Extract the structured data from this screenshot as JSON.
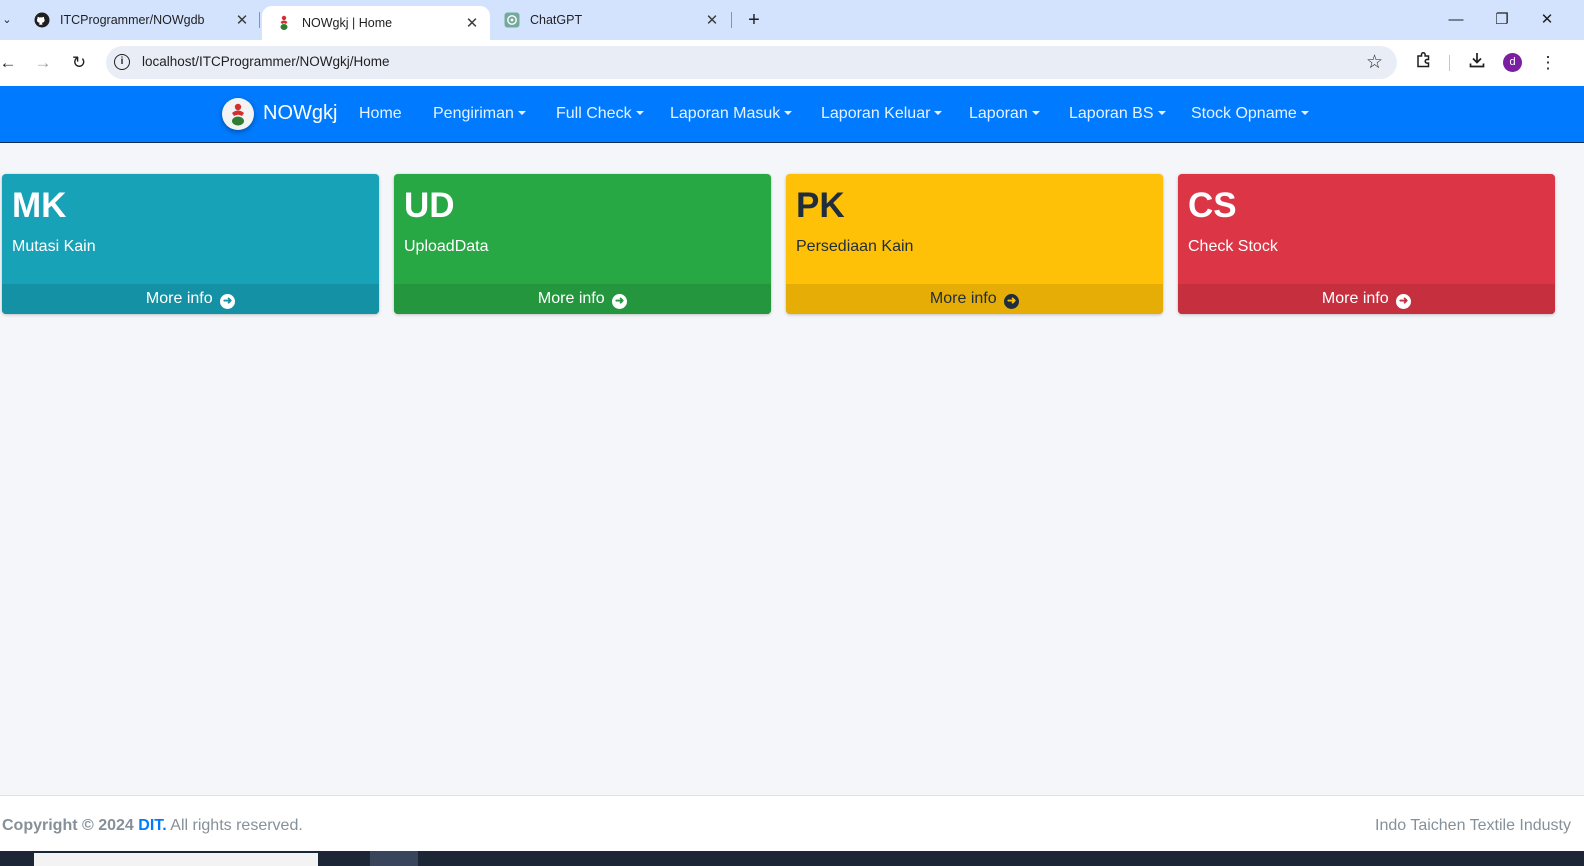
{
  "browser": {
    "tabs": [
      {
        "title": "ITCProgrammer/NOWgdb",
        "icon": "github-icon",
        "close": "✕",
        "active": false
      },
      {
        "title": "NOWgkj | Home",
        "icon": "app-favicon-icon",
        "close": "✕",
        "active": true
      },
      {
        "title": "ChatGPT",
        "icon": "chatgpt-icon",
        "close": "✕",
        "active": false
      }
    ],
    "url": "localhost/ITCProgrammer/NOWgkj/Home",
    "profile_initial": "d"
  },
  "navbar": {
    "brand": "NOWgkj",
    "items": [
      {
        "label": "Home",
        "dropdown": false
      },
      {
        "label": "Pengiriman",
        "dropdown": true
      },
      {
        "label": "Full Check",
        "dropdown": true
      },
      {
        "label": "Laporan Masuk",
        "dropdown": true
      },
      {
        "label": "Laporan Keluar",
        "dropdown": true
      },
      {
        "label": "Laporan",
        "dropdown": true
      },
      {
        "label": "Laporan BS",
        "dropdown": true
      },
      {
        "label": "Stock Opname",
        "dropdown": true
      }
    ]
  },
  "boxes": [
    {
      "code": "MK",
      "desc": "Mutasi Kain",
      "more": "More info",
      "color": "#17a2b8",
      "footer_color": "#1591a5",
      "theme": "light"
    },
    {
      "code": "UD",
      "desc": "UploadData",
      "more": "More info",
      "color": "#28a745",
      "footer_color": "#24963e",
      "theme": "light"
    },
    {
      "code": "PK",
      "desc": "Persediaan Kain",
      "more": "More info",
      "color": "#ffc107",
      "footer_color": "#e5ad06",
      "theme": "dark"
    },
    {
      "code": "CS",
      "desc": "Check Stock",
      "more": "More info",
      "color": "#dc3545",
      "footer_color": "#c62f3e",
      "theme": "light"
    }
  ],
  "footer": {
    "copyright": "Copyright © 2024",
    "company": "DIT.",
    "rights": "All rights reserved.",
    "right_text": "Indo Taichen Textile Industy"
  },
  "colors": {
    "navbar_bg": "#007bff",
    "page_bg": "#f4f6f9"
  }
}
